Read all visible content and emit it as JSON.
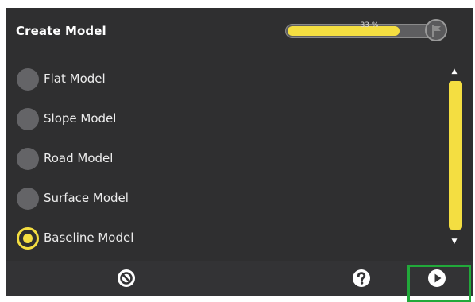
{
  "header": {
    "title": "Create Model",
    "progress": {
      "value": 0.33,
      "label": "33 %"
    },
    "finish_icon": "flag-icon"
  },
  "models": {
    "items": [
      {
        "label": "Flat Model",
        "selected": false
      },
      {
        "label": "Slope Model",
        "selected": false
      },
      {
        "label": "Road Model",
        "selected": false
      },
      {
        "label": "Surface Model",
        "selected": false
      },
      {
        "label": "Baseline Model",
        "selected": true
      }
    ]
  },
  "scroll": {
    "up_glyph": "▲",
    "down_glyph": "▼"
  },
  "footer": {
    "cancel_icon": "cancel-icon",
    "help_icon": "help-icon",
    "next_icon": "play-next-icon"
  },
  "colors": {
    "accent": "#f4de41",
    "background": "#2f2f30",
    "highlight": "#21a93a"
  }
}
